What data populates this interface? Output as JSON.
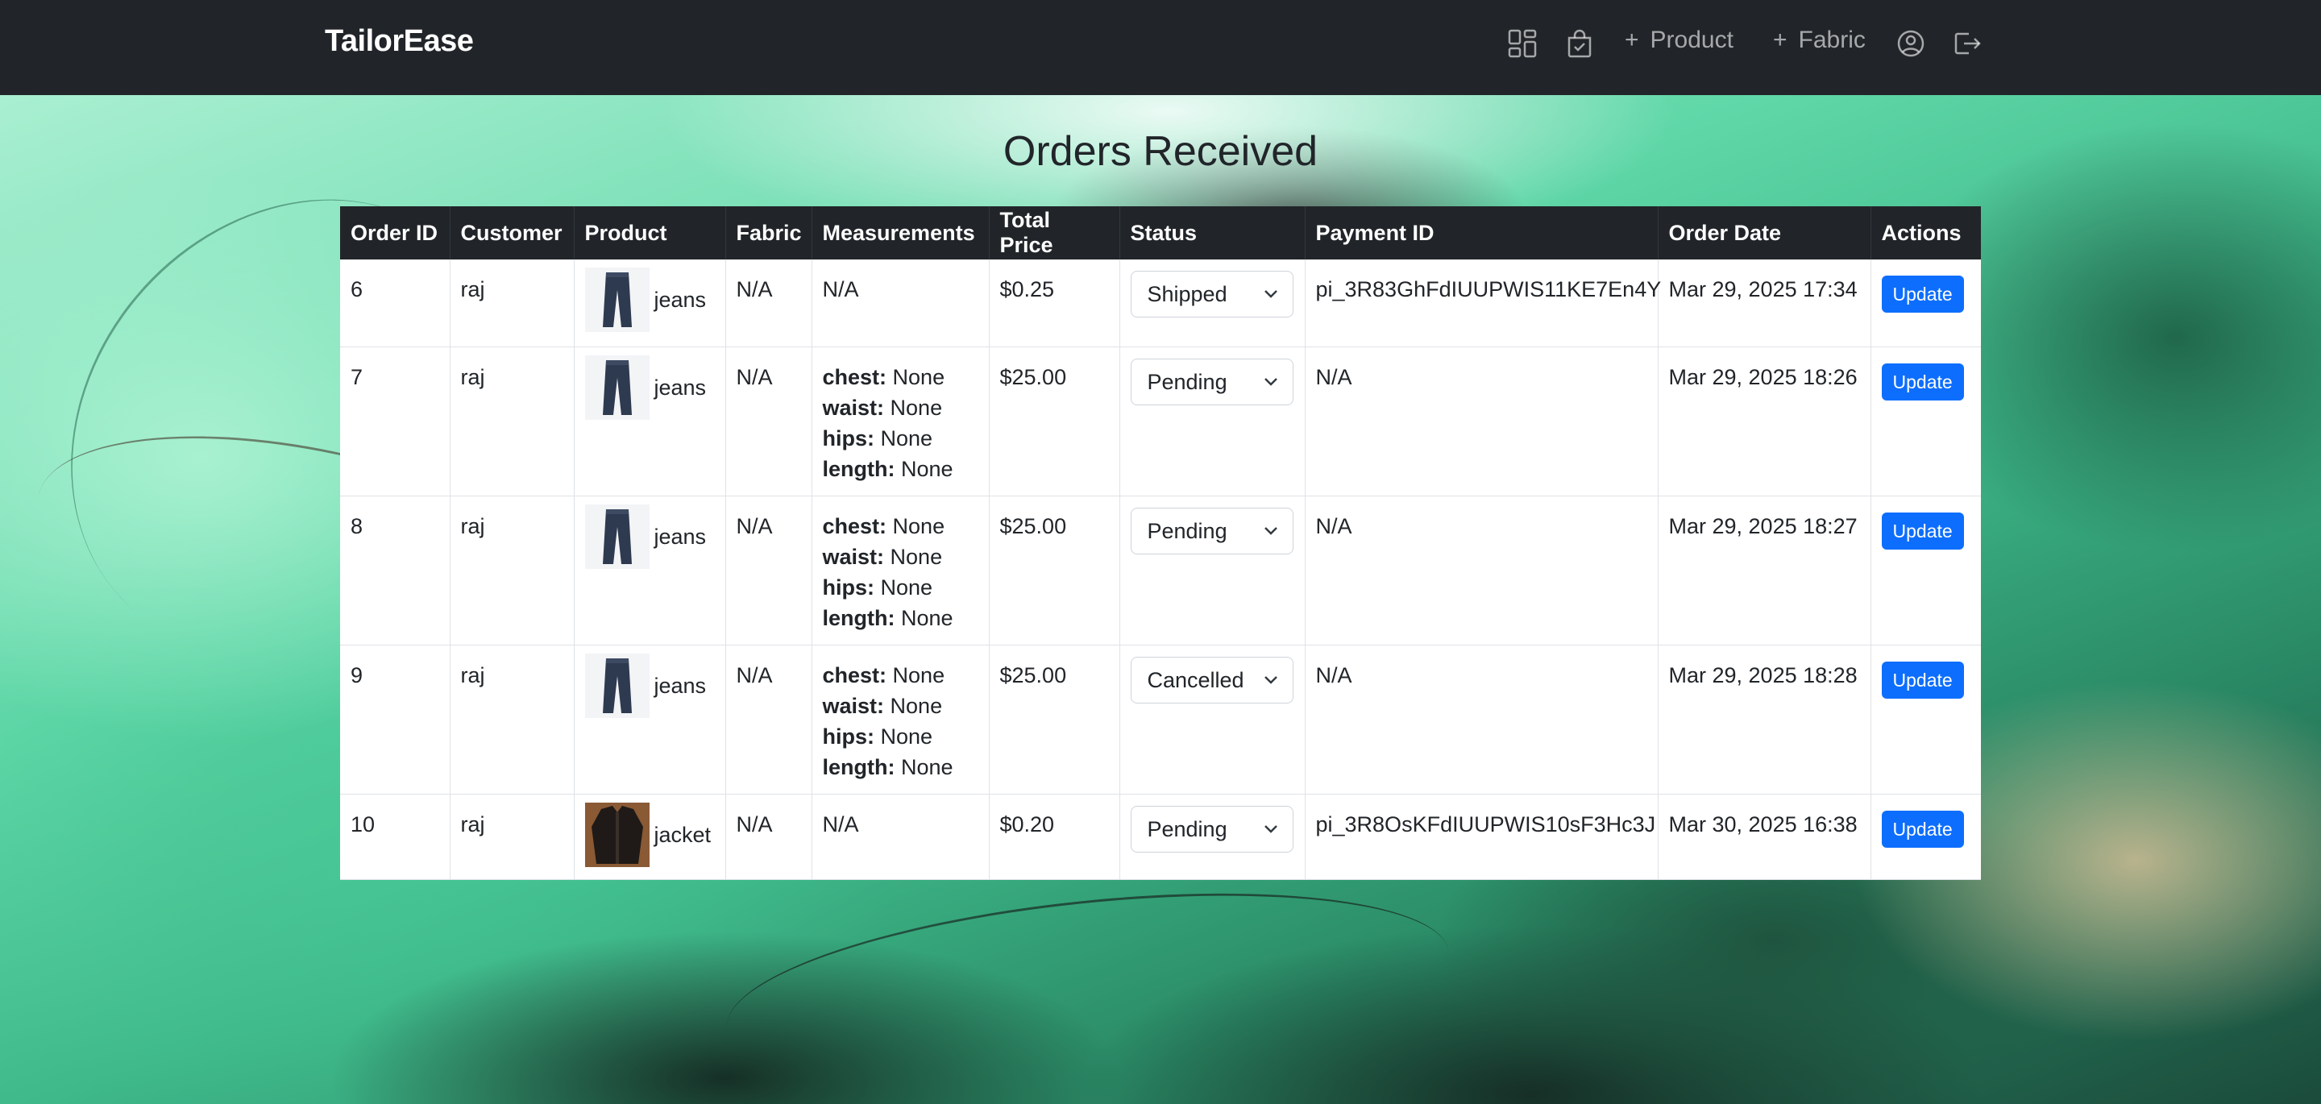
{
  "navbar": {
    "brand": "TailorEase",
    "icons": [
      "grid-icon",
      "shopping-bag-icon",
      "user-circle-icon",
      "logout-icon"
    ],
    "add_product_label": "Product",
    "add_fabric_label": "Fabric"
  },
  "page": {
    "title": "Orders Received"
  },
  "table": {
    "headers": [
      "Order ID",
      "Customer",
      "Product",
      "Fabric",
      "Measurements",
      "Total Price",
      "Status",
      "Payment ID",
      "Order Date",
      "Actions"
    ],
    "rows": [
      {
        "order_id": "6",
        "customer": "raj",
        "product": "jeans",
        "fabric": "N/A",
        "measurements_text": "N/A",
        "total_price": "$0.25",
        "status": "Shipped",
        "payment_id": "pi_3R83GhFdIUUPWIS11KE7En4Y",
        "order_date": "Mar 29, 2025 17:34",
        "action": "Update"
      },
      {
        "order_id": "7",
        "customer": "raj",
        "product": "jeans",
        "fabric": "N/A",
        "measurements": {
          "chest_label": "chest:",
          "chest": "None",
          "waist_label": "waist:",
          "waist": "None",
          "hips_label": "hips:",
          "hips": "None",
          "length_label": "length:",
          "length": "None"
        },
        "total_price": "$25.00",
        "status": "Pending",
        "payment_id": "N/A",
        "order_date": "Mar 29, 2025 18:26",
        "action": "Update"
      },
      {
        "order_id": "8",
        "customer": "raj",
        "product": "jeans",
        "fabric": "N/A",
        "measurements": {
          "chest_label": "chest:",
          "chest": "None",
          "waist_label": "waist:",
          "waist": "None",
          "hips_label": "hips:",
          "hips": "None",
          "length_label": "length:",
          "length": "None"
        },
        "total_price": "$25.00",
        "status": "Pending",
        "payment_id": "N/A",
        "order_date": "Mar 29, 2025 18:27",
        "action": "Update"
      },
      {
        "order_id": "9",
        "customer": "raj",
        "product": "jeans",
        "fabric": "N/A",
        "measurements": {
          "chest_label": "chest:",
          "chest": "None",
          "waist_label": "waist:",
          "waist": "None",
          "hips_label": "hips:",
          "hips": "None",
          "length_label": "length:",
          "length": "None"
        },
        "total_price": "$25.00",
        "status": "Cancelled",
        "payment_id": "N/A",
        "order_date": "Mar 29, 2025 18:28",
        "action": "Update"
      },
      {
        "order_id": "10",
        "customer": "raj",
        "product": "jacket",
        "fabric": "N/A",
        "measurements_text": "N/A",
        "total_price": "$0.20",
        "status": "Pending",
        "payment_id": "pi_3R8OsKFdIUUPWIS10sF3Hc3J",
        "order_date": "Mar 30, 2025 16:38",
        "action": "Update"
      }
    ]
  },
  "colors": {
    "navbar_bg": "#212529",
    "primary_button": "#0d6efd",
    "table_header_bg": "#212529"
  }
}
